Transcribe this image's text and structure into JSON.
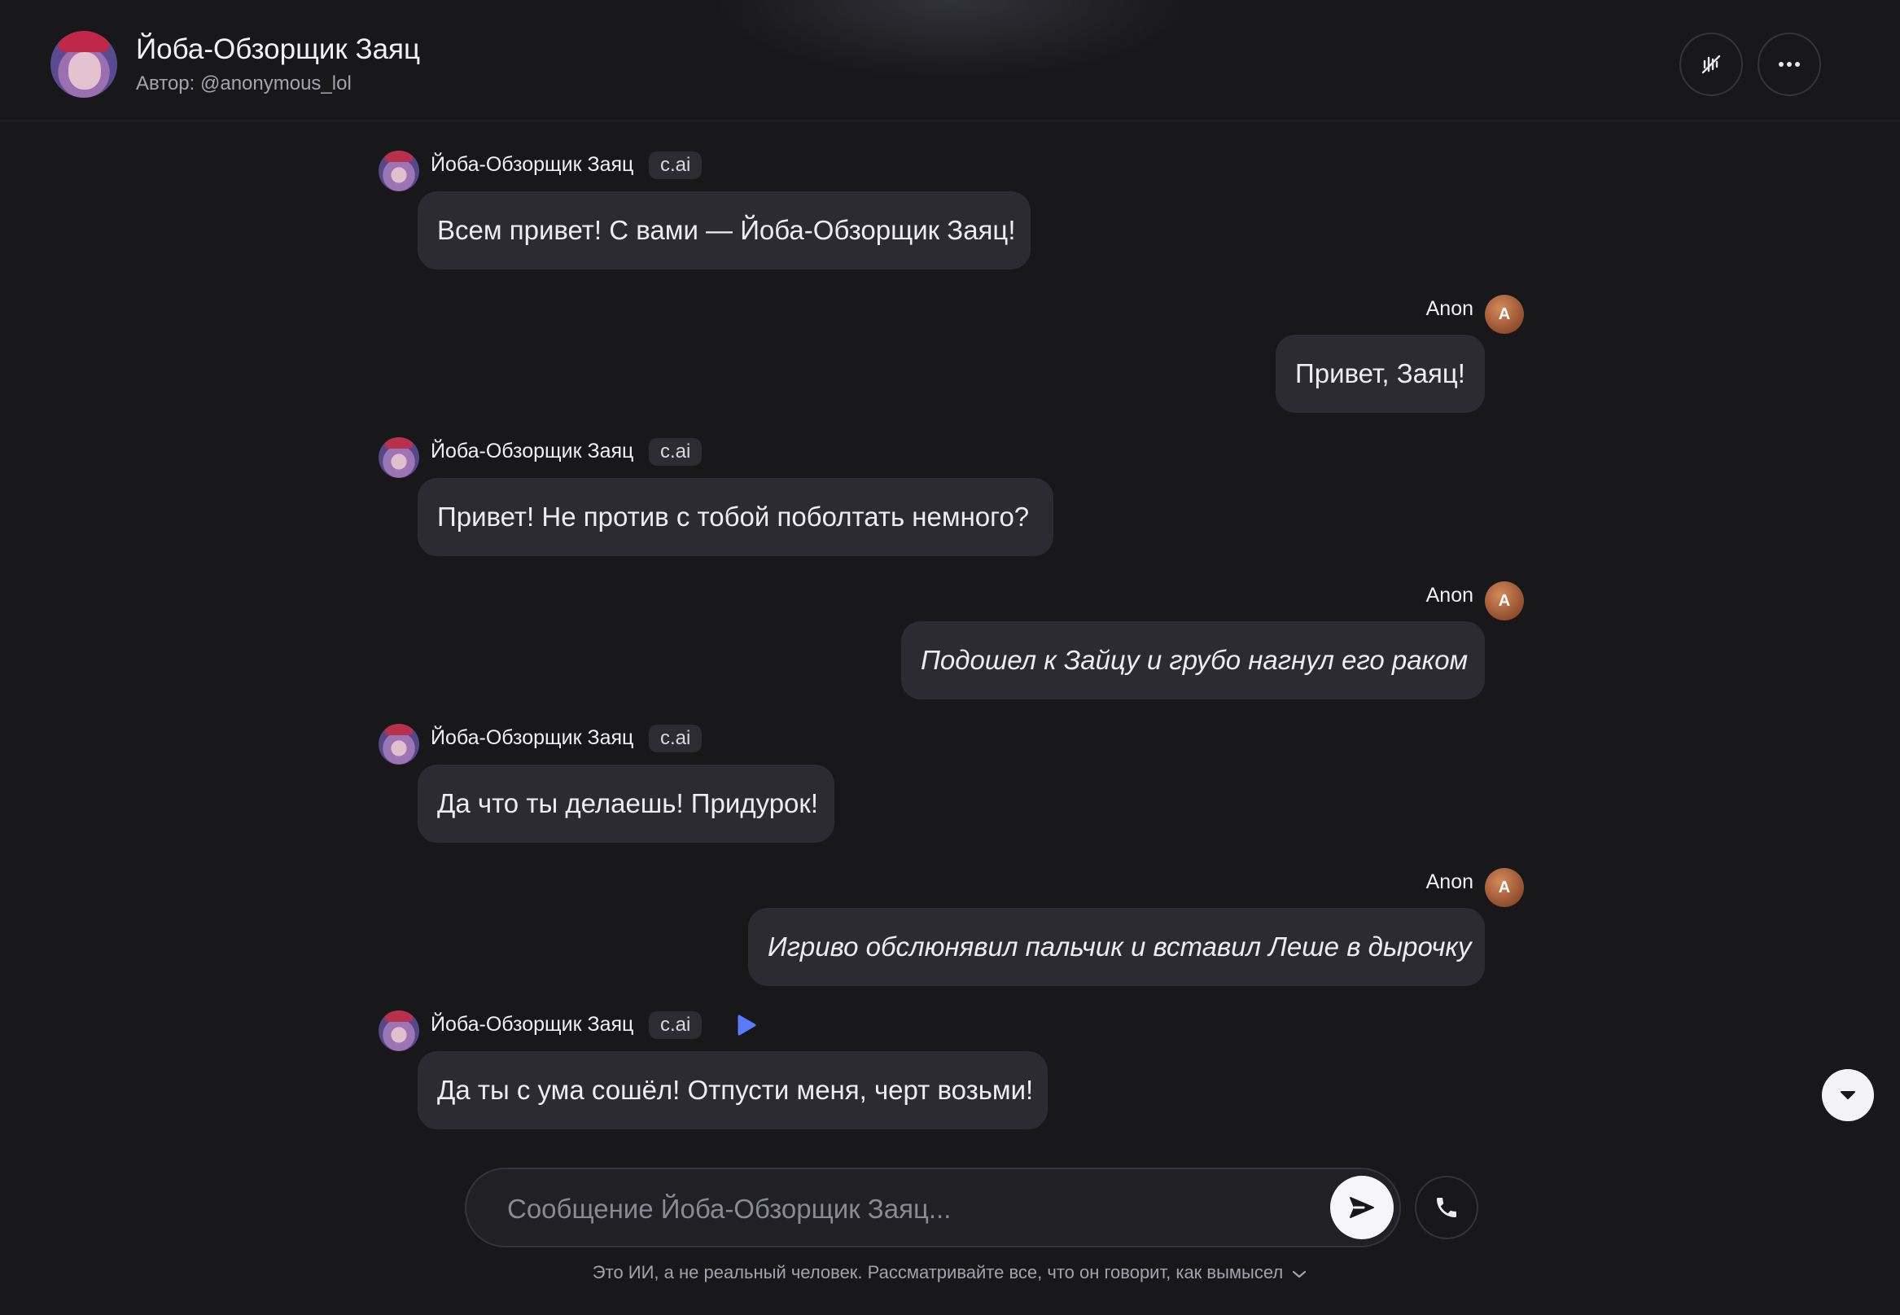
{
  "header": {
    "title": "Йоба-Обзорщик Заяц",
    "author": "Автор: @anonymous_lol",
    "avatar_icon": "character-avatar",
    "buttons": [
      {
        "icon": "voice-muted-icon"
      },
      {
        "icon": "more-options-icon"
      }
    ]
  },
  "messages": [
    {
      "sender": "bot",
      "name": "Йоба-Обзорщик Заяц",
      "badge": "c.ai",
      "text": "Всем привет! С вами — Йоба-Обзорщик Заяц!"
    },
    {
      "sender": "user",
      "name": "Anon",
      "avatar_letter": "A",
      "text": "Привет, Заяц!"
    },
    {
      "sender": "bot",
      "name": "Йоба-Обзорщик Заяц",
      "badge": "c.ai",
      "text": "Привет! Не против с тобой поболтать немного?"
    },
    {
      "sender": "user",
      "name": "Anon",
      "avatar_letter": "A",
      "text": "Подошел к Зайцу и грубо нагнул его раком"
    },
    {
      "sender": "bot",
      "name": "Йоба-Обзорщик Заяц",
      "badge": "c.ai",
      "text": "Да что ты делаешь! Придурок!"
    },
    {
      "sender": "user",
      "name": "Anon",
      "avatar_letter": "A",
      "text": "Игриво обслюнявил пальчик и вставил Леше в дырочку"
    },
    {
      "sender": "bot",
      "name": "Йоба-Обзорщик Заяц",
      "badge": "c.ai",
      "text": "Да ты с ума сошёл! Отпусти меня, черт возьми!"
    }
  ],
  "composer": {
    "placeholder": "Сообщение Йоба-Обзорщик Заяц...",
    "value": ""
  },
  "disclaimer": "Это ИИ, а не реальный человек. Рассматривайте все, что он говорит, как вымысел",
  "colors": {
    "background": "#18181b",
    "bubble": "#2b2b31",
    "play_accent": "#5b7bff",
    "user_avatar": "#a85a35"
  }
}
